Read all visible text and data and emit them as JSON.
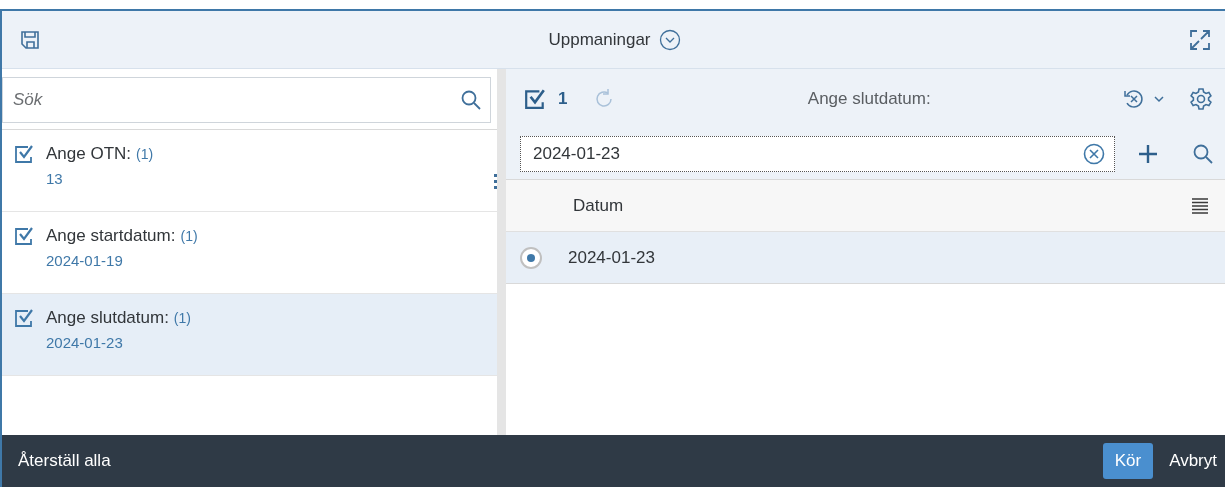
{
  "header": {
    "title": "Uppmaningar"
  },
  "search": {
    "placeholder": "Sök"
  },
  "prompts": [
    {
      "label": "Ange OTN:",
      "count": "(1)",
      "value": "13",
      "checked": true,
      "selected": false
    },
    {
      "label": "Ange startdatum:",
      "count": "(1)",
      "value": "2024-01-19",
      "checked": true,
      "selected": false
    },
    {
      "label": "Ange slutdatum:",
      "count": "(1)",
      "value": "2024-01-23",
      "checked": true,
      "selected": true
    }
  ],
  "detail": {
    "selected_count": "1",
    "title": "Ange slutdatum:",
    "input_value": "2024-01-23",
    "column": "Datum",
    "rows": [
      {
        "value": "2024-01-23",
        "selected": true
      }
    ]
  },
  "footer": {
    "reset": "Återställ alla",
    "run": "Kör",
    "cancel": "Avbryt"
  }
}
